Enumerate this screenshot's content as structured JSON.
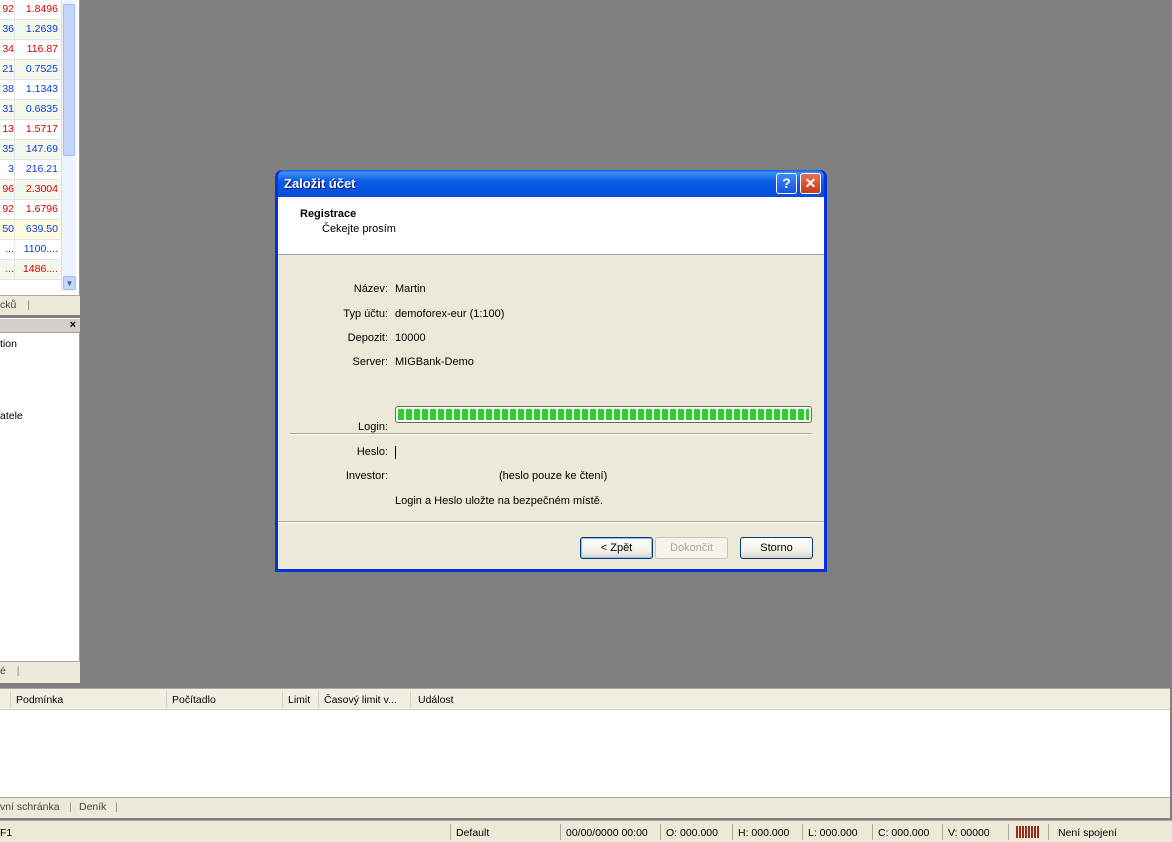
{
  "market_watch": {
    "rows": [
      {
        "a": "92",
        "b": "1.8496",
        "dir": "dn"
      },
      {
        "a": "36",
        "b": "1.2639",
        "dir": "up"
      },
      {
        "a": "34",
        "b": "116.87",
        "dir": "dn"
      },
      {
        "a": "21",
        "b": "0.7525",
        "dir": "up"
      },
      {
        "a": "38",
        "b": "1.1343",
        "dir": "up"
      },
      {
        "a": "31",
        "b": "0.6835",
        "dir": "up"
      },
      {
        "a": "13",
        "b": "1.5717",
        "dir": "dn"
      },
      {
        "a": "35",
        "b": "147.69",
        "dir": "up"
      },
      {
        "a": "3",
        "b": "216.21",
        "dir": "up"
      },
      {
        "a": "96",
        "b": "2.3004",
        "dir": "dn"
      },
      {
        "a": "92",
        "b": "1.6796",
        "dir": "dn"
      },
      {
        "a": "50",
        "b": "639.50",
        "dir": "up"
      },
      {
        "a": "...",
        "b": "1100....",
        "dir": "up"
      },
      {
        "a": "...",
        "b": "1486....",
        "dir": "dn"
      }
    ],
    "tab_label": "cků"
  },
  "navigator": {
    "items": [
      "tion",
      "atele"
    ],
    "tab_label": "é"
  },
  "terminal": {
    "columns": [
      "Podmínka",
      "Počítadlo",
      "Limit",
      "Časový limit v...",
      "Událost"
    ],
    "tabs": [
      "vní schránka",
      "Deník"
    ]
  },
  "status_bar": {
    "help": "F1",
    "profile": "Default",
    "datetime": "00/00/0000 00:00",
    "open": "O: 000.000",
    "high": "H: 000.000",
    "low": "L: 000.000",
    "close": "C: 000.000",
    "volume": "V: 00000",
    "connection": "Není spojení"
  },
  "dialog": {
    "title": "Založit účet",
    "help_btn": "?",
    "close_btn": "✕",
    "header_title": "Registrace",
    "header_subtitle": "Čekejte prosím",
    "fields": {
      "name_label": "Název:",
      "name_value": "Martin",
      "type_label": "Typ účtu:",
      "type_value": "demoforex-eur (1:100)",
      "deposit_label": "Depozit:",
      "deposit_value": "10000",
      "server_label": "Server:",
      "server_value": "MIGBank-Demo"
    },
    "progress": 1.0,
    "login_label": "Login:",
    "password_label": "Heslo:",
    "investor_label": "Investor:",
    "investor_note": "(heslo pouze ke čtení)",
    "save_note": "Login a Heslo uložte na bezpečném místě.",
    "buttons": {
      "back": "< Zpět",
      "finish": "Dokončit",
      "cancel": "Storno"
    }
  }
}
